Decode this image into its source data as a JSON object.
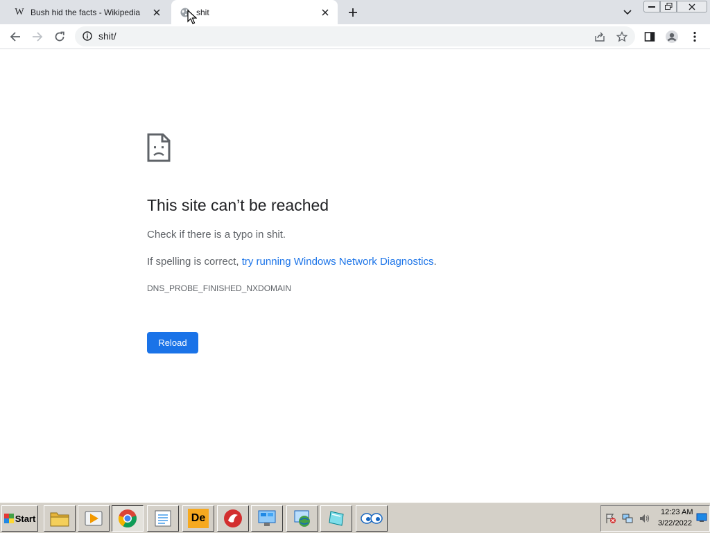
{
  "tabs": [
    {
      "title": "Bush hid the facts - Wikipedia",
      "favicon": "wikipedia-icon",
      "favicon_glyph": "W",
      "active": false
    },
    {
      "title": "shit",
      "favicon": "globe-icon",
      "active": true
    }
  ],
  "address_bar": {
    "url": "shit/"
  },
  "error_page": {
    "heading": "This site can’t be reached",
    "line1": "Check if there is a typo in shit.",
    "line2_prefix": "If spelling is correct, ",
    "line2_link": "try running Windows Network Diagnostics",
    "line2_suffix": ".",
    "error_code": "DNS_PROBE_FINISHED_NXDOMAIN",
    "reload_label": "Reload"
  },
  "taskbar": {
    "start_label": "Start",
    "items": [
      {
        "name": "file-manager-icon"
      },
      {
        "name": "media-player-icon"
      },
      {
        "name": "chrome-icon",
        "active": true
      },
      {
        "name": "notepad-icon"
      },
      {
        "name": "app-de-icon",
        "glyph": "De"
      },
      {
        "name": "red-app-icon"
      },
      {
        "name": "network-app-icon"
      },
      {
        "name": "globe-app-icon"
      },
      {
        "name": "tablet-app-icon"
      },
      {
        "name": "eyes-app-icon"
      }
    ],
    "clock": {
      "time": "12:23 AM",
      "date": "3/22/2022"
    }
  },
  "colors": {
    "accent": "#1a73e8",
    "tab_strip": "#dee1e6",
    "taskbar": "#d4d0c8"
  }
}
